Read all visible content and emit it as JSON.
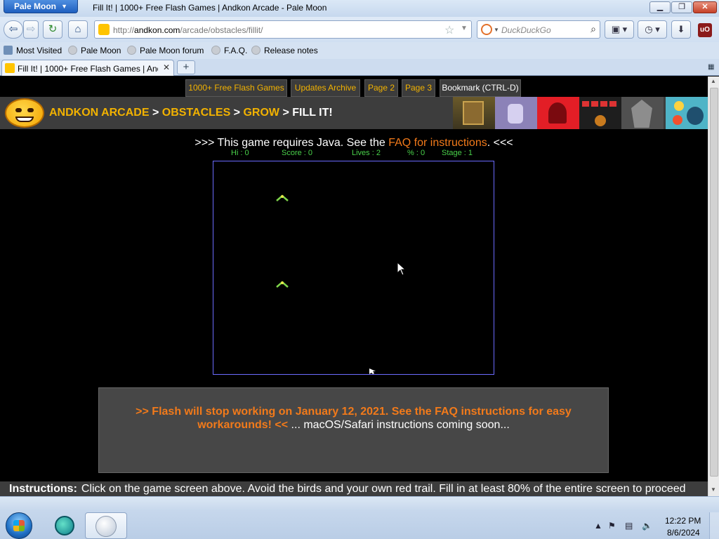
{
  "window": {
    "app_menu": "Pale Moon",
    "title": "Fill It! | 1000+ Free Flash Games | Andkon Arcade - Pale Moon"
  },
  "navbar": {
    "url_prefix": "http://",
    "url_host": "andkon.com",
    "url_path": "/arcade/obstacles/fillit/",
    "search_placeholder": "DuckDuckGo",
    "ublock_badge": "uO"
  },
  "bookmarks": {
    "items": [
      "Most Visited",
      "Pale Moon",
      "Pale Moon forum",
      "F.A.Q.",
      "Release notes"
    ]
  },
  "tab": {
    "label": "Fill It! | 1000+ Free Flash Games | Andkon Arcade"
  },
  "page": {
    "topnav": [
      "1000+ Free Flash Games",
      "Updates Archive",
      "Page 2",
      "Page 3",
      "Bookmark (CTRL-D)"
    ],
    "breadcrumb": {
      "items": [
        "ANDKON ARCADE",
        "OBSTACLES",
        "GROW"
      ],
      "separator": " > ",
      "current": "FILL IT!"
    },
    "java_notice": {
      "before": ">>> This game requires Java. See the ",
      "link": "FAQ for instructions",
      "after": ". <<<"
    },
    "hud": {
      "hi": "Hi : 0",
      "score": "Score : 0",
      "lives": "Lives : 2",
      "percent": "% : 0",
      "stage": "Stage : 1"
    },
    "flash_notice": {
      "warning": ">> Flash will stop working on January 12, 2021. See the FAQ instructions for easy workarounds! <<",
      "soon": " ... macOS/Safari instructions coming soon..."
    },
    "instructions": {
      "label": "Instructions:",
      "text": "Click on the game screen above. Avoid the birds and your own red trail. Fill in at least 80% of the entire screen to proceed"
    }
  },
  "taskbar": {
    "time": "12:22 PM",
    "date": "8/6/2024"
  },
  "colors": {
    "accent_orange": "#f27a1a",
    "crumb_yellow": "#f2b200",
    "hud_green": "#49d14a",
    "game_border": "#6b6bff"
  }
}
